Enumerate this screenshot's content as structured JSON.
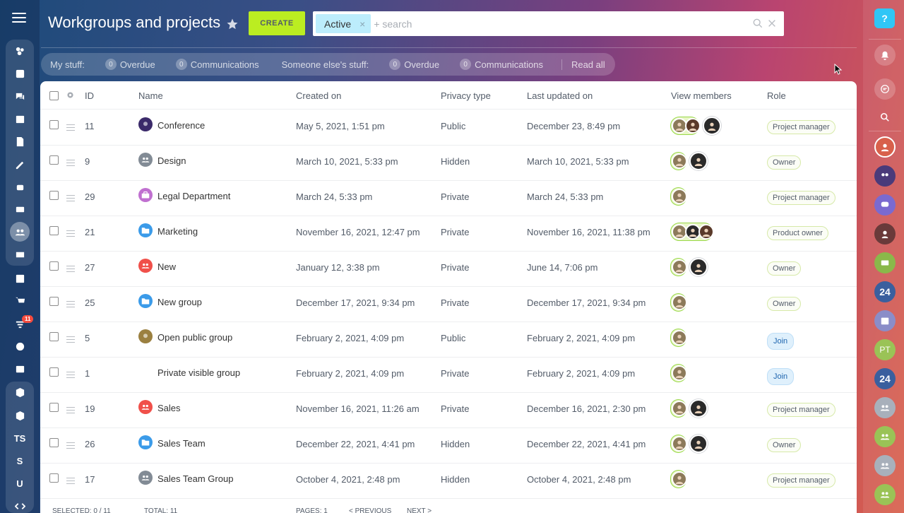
{
  "header": {
    "title": "Workgroups and projects",
    "create_label": "CREATE",
    "filter_tag": "Active",
    "search_placeholder": "+ search"
  },
  "counters": {
    "my_label": "My stuff:",
    "my_overdue_count": "0",
    "my_overdue_label": "Overdue",
    "my_comm_count": "0",
    "my_comm_label": "Communications",
    "else_label": "Someone else's stuff:",
    "else_overdue_count": "0",
    "else_overdue_label": "Overdue",
    "else_comm_count": "0",
    "else_comm_label": "Communications",
    "read_all": "Read all"
  },
  "table": {
    "columns": [
      "ID",
      "Name",
      "Created on",
      "Privacy type",
      "Last updated on",
      "View members",
      "Role"
    ],
    "rows": [
      {
        "id": "11",
        "name": "Conference",
        "icon": "photo-icon",
        "icon_color": "#3b2a6a",
        "created": "May 5, 2021, 1:51 pm",
        "privacy": "Public",
        "updated": "December 23, 8:49 pm",
        "members": "group-2+1",
        "role": "Project manager"
      },
      {
        "id": "9",
        "name": "Design",
        "icon": "people-icon",
        "icon_color": "#828b95",
        "created": "March 10, 2021, 5:33 pm",
        "privacy": "Hidden",
        "updated": "March 10, 2021, 5:33 pm",
        "members": "1+1",
        "role": "Owner"
      },
      {
        "id": "29",
        "name": "Legal Department",
        "icon": "briefcase-icon",
        "icon_color": "#c070d0",
        "created": "March 24, 5:33 pm",
        "privacy": "Private",
        "updated": "March 24, 5:33 pm",
        "members": "1",
        "role": "Project manager"
      },
      {
        "id": "21",
        "name": "Marketing",
        "icon": "folder-icon",
        "icon_color": "#3b9be9",
        "created": "November 16, 2021, 12:47 pm",
        "privacy": "Private",
        "updated": "November 16, 2021, 11:38 pm",
        "members": "group-3",
        "role": "Product owner"
      },
      {
        "id": "27",
        "name": "New",
        "icon": "people-icon",
        "icon_color": "#f0504a",
        "created": "January 12, 3:38 pm",
        "privacy": "Private",
        "updated": "June 14, 7:06 pm",
        "members": "1+1",
        "role": "Owner"
      },
      {
        "id": "25",
        "name": "New group",
        "icon": "folder-icon",
        "icon_color": "#3b9be9",
        "created": "December 17, 2021, 9:34 pm",
        "privacy": "Private",
        "updated": "December 17, 2021, 9:34 pm",
        "members": "1",
        "role": "Owner"
      },
      {
        "id": "5",
        "name": "Open public group",
        "icon": "photo-icon",
        "icon_color": "#9b8040",
        "created": "February 2, 2021, 4:09 pm",
        "privacy": "Public",
        "updated": "February 2, 2021, 4:09 pm",
        "members": "1",
        "role": "Join"
      },
      {
        "id": "1",
        "name": "Private visible group",
        "icon": "",
        "icon_color": "",
        "created": "February 2, 2021, 4:09 pm",
        "privacy": "Private",
        "updated": "February 2, 2021, 4:09 pm",
        "members": "1",
        "role": "Join"
      },
      {
        "id": "19",
        "name": "Sales",
        "icon": "people-icon",
        "icon_color": "#f0504a",
        "created": "November 16, 2021, 11:26 am",
        "privacy": "Private",
        "updated": "December 16, 2021, 2:30 pm",
        "members": "1+1",
        "role": "Project manager"
      },
      {
        "id": "26",
        "name": "Sales Team",
        "icon": "folder-icon",
        "icon_color": "#3b9be9",
        "created": "December 22, 2021, 4:41 pm",
        "privacy": "Hidden",
        "updated": "December 22, 2021, 4:41 pm",
        "members": "1+1",
        "role": "Owner"
      },
      {
        "id": "17",
        "name": "Sales Team Group",
        "icon": "people-icon",
        "icon_color": "#828b95",
        "created": "October 4, 2021, 2:48 pm",
        "privacy": "Hidden",
        "updated": "October 4, 2021, 2:48 pm",
        "members": "1",
        "role": "Project manager"
      }
    ]
  },
  "footer": {
    "selected_label": "SELECTED: 0 / 11",
    "total_label": "TOTAL: 11",
    "pages_label": "PAGES: 1",
    "previous": "< PREVIOUS",
    "next": "NEXT >"
  },
  "left_nav": {
    "text_items": [
      "TS",
      "S",
      "U"
    ],
    "badge": "11"
  },
  "right_bar": {
    "help": "?",
    "labels": [
      "24",
      "PT",
      "24"
    ]
  },
  "colors": {
    "create": "#bbed21",
    "filter_tag": "#bcedfc",
    "help": "#2fc6f6"
  }
}
